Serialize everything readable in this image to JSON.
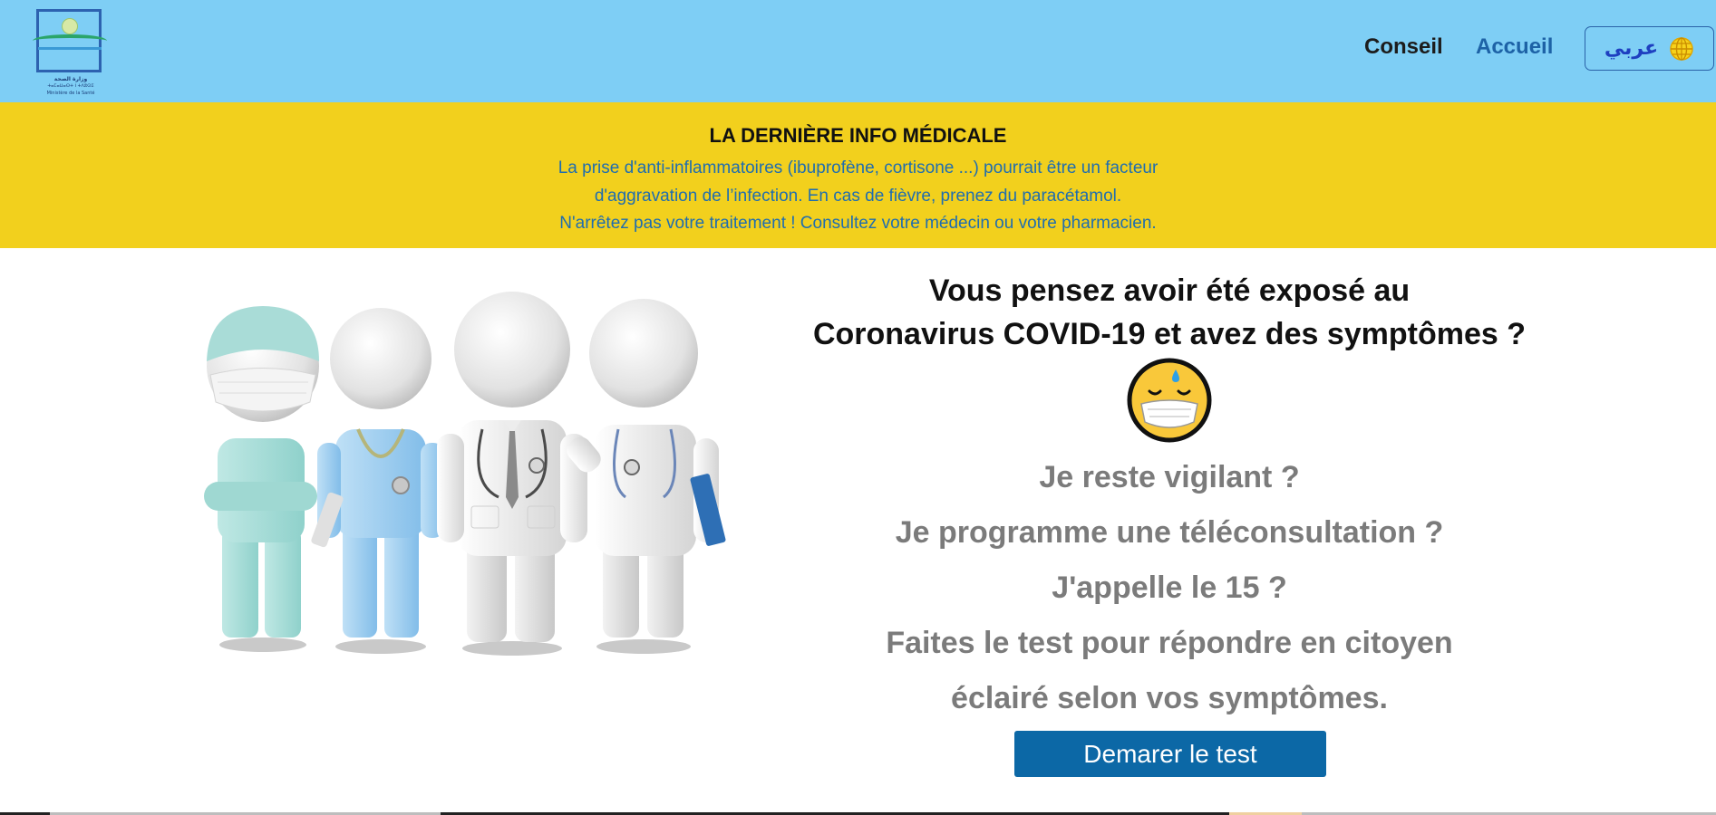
{
  "header": {
    "logo": {
      "icon": "ministry-logo",
      "caption_line1": "وزارة الصحة",
      "caption_line2": "ⵜⴰⵎⴰⵡⴰⵙⵜ ⵏ ⵜⴷⵓⵙⵉ",
      "caption_line3": "Ministère de la Santé"
    },
    "nav": {
      "conseil": "Conseil",
      "accueil": "Accueil",
      "language_label": "عربي",
      "language_icon": "globe-icon"
    },
    "colors": {
      "background": "#7ecef5",
      "accueil": "#1d62a6"
    }
  },
  "info_band": {
    "title": "LA DERNIÈRE INFO MÉDICALE",
    "lines": [
      "La prise d'anti-inflammatoires (ibuprofène, cortisone ...) pourrait être un facteur",
      "d'aggravation de l’infection. En cas de fièvre, prenez du paracétamol.",
      "N'arrêtez pas votre traitement ! Consultez votre médecin ou votre pharmacien."
    ],
    "colors": {
      "background": "#f2d01d",
      "text": "#1f6db0"
    }
  },
  "illustration": {
    "icon": "medical-staff-illustration"
  },
  "main": {
    "headline": [
      "Vous pensez avoir été exposé au",
      "Coronavirus COVID-19 et avez des symptômes ?"
    ],
    "emoji_icon": "masked-face-emoji-icon",
    "questions": [
      "Je reste vigilant ?",
      "Je programme une téléconsultation ?",
      "J'appelle le 15 ?",
      "Faites le test pour répondre en citoyen",
      "éclairé selon vos symptômes."
    ],
    "cta_label": "Demarer le test",
    "colors": {
      "cta": "#0c68a6",
      "question_text": "#7b7b7b"
    }
  }
}
